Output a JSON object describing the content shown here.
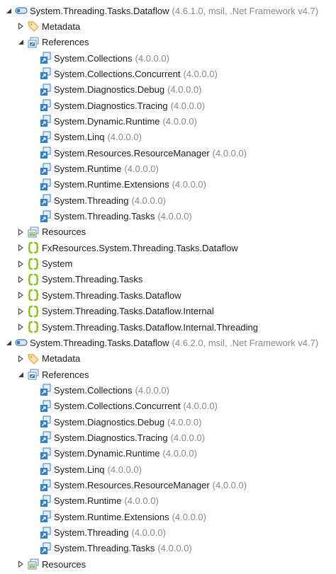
{
  "colors": {
    "text": "#1e1e1e",
    "version_text": "#8a8a8a",
    "assembly_icon": "#3a78c6",
    "reference_icon": "#2f7fd1",
    "namespace_icon": "#8cc21f",
    "metadata_icon": "#e8a33a",
    "folder_icon": "#5b8dc9"
  },
  "tree": [
    {
      "level": 0,
      "expand": "expanded",
      "icon": "assembly-icon",
      "label": "System.Threading.Tasks.Dataflow",
      "version": "(4.6.1.0, msil, .Net Framework v4.7)"
    },
    {
      "level": 1,
      "expand": "collapsed",
      "icon": "metadata-tag-icon",
      "label": "Metadata",
      "version": ""
    },
    {
      "level": 1,
      "expand": "expanded",
      "icon": "references-folder-icon",
      "label": "References",
      "version": ""
    },
    {
      "level": 2,
      "expand": "none",
      "icon": "reference-icon",
      "label": "System.Collections",
      "version": "(4.0.0.0)"
    },
    {
      "level": 2,
      "expand": "none",
      "icon": "reference-icon",
      "label": "System.Collections.Concurrent",
      "version": "(4.0.0.0)"
    },
    {
      "level": 2,
      "expand": "none",
      "icon": "reference-icon",
      "label": "System.Diagnostics.Debug",
      "version": "(4.0.0.0)"
    },
    {
      "level": 2,
      "expand": "none",
      "icon": "reference-icon",
      "label": "System.Diagnostics.Tracing",
      "version": "(4.0.0.0)"
    },
    {
      "level": 2,
      "expand": "none",
      "icon": "reference-icon",
      "label": "System.Dynamic.Runtime",
      "version": "(4.0.0.0)"
    },
    {
      "level": 2,
      "expand": "none",
      "icon": "reference-icon",
      "label": "System.Linq",
      "version": "(4.0.0.0)"
    },
    {
      "level": 2,
      "expand": "none",
      "icon": "reference-icon",
      "label": "System.Resources.ResourceManager",
      "version": "(4.0.0.0)"
    },
    {
      "level": 2,
      "expand": "none",
      "icon": "reference-icon",
      "label": "System.Runtime",
      "version": "(4.0.0.0)"
    },
    {
      "level": 2,
      "expand": "none",
      "icon": "reference-icon",
      "label": "System.Runtime.Extensions",
      "version": "(4.0.0.0)"
    },
    {
      "level": 2,
      "expand": "none",
      "icon": "reference-icon",
      "label": "System.Threading",
      "version": "(4.0.0.0)"
    },
    {
      "level": 2,
      "expand": "none",
      "icon": "reference-icon",
      "label": "System.Threading.Tasks",
      "version": "(4.0.0.0)"
    },
    {
      "level": 1,
      "expand": "collapsed",
      "icon": "resources-folder-icon",
      "label": "Resources",
      "version": ""
    },
    {
      "level": 1,
      "expand": "collapsed",
      "icon": "namespace-icon",
      "label": "FxResources.System.Threading.Tasks.Dataflow",
      "version": ""
    },
    {
      "level": 1,
      "expand": "collapsed",
      "icon": "namespace-icon",
      "label": "System",
      "version": ""
    },
    {
      "level": 1,
      "expand": "collapsed",
      "icon": "namespace-icon",
      "label": "System.Threading.Tasks",
      "version": ""
    },
    {
      "level": 1,
      "expand": "collapsed",
      "icon": "namespace-icon",
      "label": "System.Threading.Tasks.Dataflow",
      "version": ""
    },
    {
      "level": 1,
      "expand": "collapsed",
      "icon": "namespace-icon",
      "label": "System.Threading.Tasks.Dataflow.Internal",
      "version": ""
    },
    {
      "level": 1,
      "expand": "collapsed",
      "icon": "namespace-icon",
      "label": "System.Threading.Tasks.Dataflow.Internal.Threading",
      "version": ""
    },
    {
      "level": 0,
      "expand": "expanded",
      "icon": "assembly-icon",
      "label": "System.Threading.Tasks.Dataflow",
      "version": "(4.6.2.0, msil, .Net Framework v4.7)"
    },
    {
      "level": 1,
      "expand": "collapsed",
      "icon": "metadata-tag-icon",
      "label": "Metadata",
      "version": ""
    },
    {
      "level": 1,
      "expand": "expanded",
      "icon": "references-folder-icon",
      "label": "References",
      "version": ""
    },
    {
      "level": 2,
      "expand": "none",
      "icon": "reference-icon",
      "label": "System.Collections",
      "version": "(4.0.0.0)"
    },
    {
      "level": 2,
      "expand": "none",
      "icon": "reference-icon",
      "label": "System.Collections.Concurrent",
      "version": "(4.0.0.0)"
    },
    {
      "level": 2,
      "expand": "none",
      "icon": "reference-icon",
      "label": "System.Diagnostics.Debug",
      "version": "(4.0.0.0)"
    },
    {
      "level": 2,
      "expand": "none",
      "icon": "reference-icon",
      "label": "System.Diagnostics.Tracing",
      "version": "(4.0.0.0)"
    },
    {
      "level": 2,
      "expand": "none",
      "icon": "reference-icon",
      "label": "System.Dynamic.Runtime",
      "version": "(4.0.0.0)"
    },
    {
      "level": 2,
      "expand": "none",
      "icon": "reference-icon",
      "label": "System.Linq",
      "version": "(4.0.0.0)"
    },
    {
      "level": 2,
      "expand": "none",
      "icon": "reference-icon",
      "label": "System.Resources.ResourceManager",
      "version": "(4.0.0.0)"
    },
    {
      "level": 2,
      "expand": "none",
      "icon": "reference-icon",
      "label": "System.Runtime",
      "version": "(4.0.0.0)"
    },
    {
      "level": 2,
      "expand": "none",
      "icon": "reference-icon",
      "label": "System.Runtime.Extensions",
      "version": "(4.0.0.0)"
    },
    {
      "level": 2,
      "expand": "none",
      "icon": "reference-icon",
      "label": "System.Threading",
      "version": "(4.0.0.0)"
    },
    {
      "level": 2,
      "expand": "none",
      "icon": "reference-icon",
      "label": "System.Threading.Tasks",
      "version": "(4.0.0.0)"
    },
    {
      "level": 1,
      "expand": "collapsed",
      "icon": "resources-folder-icon",
      "label": "Resources",
      "version": ""
    }
  ]
}
